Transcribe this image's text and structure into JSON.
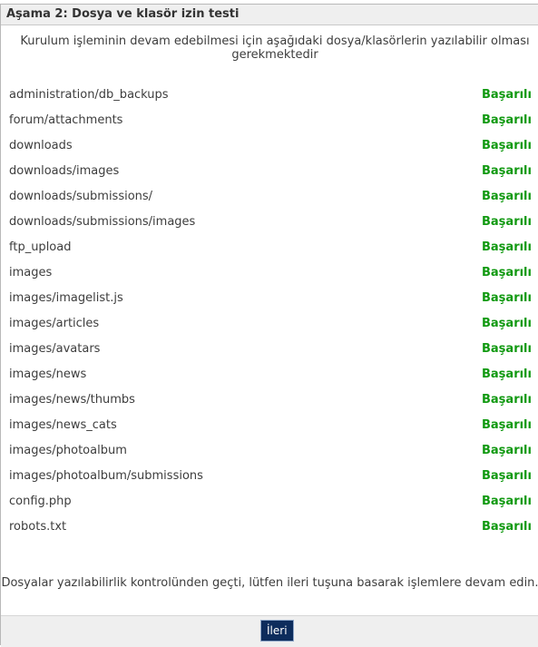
{
  "header": {
    "title": "Aşama 2: Dosya ve klasör izin testi"
  },
  "intro": {
    "text": "Kurulum işleminin devam edebilmesi için aşağıdaki dosya/klasörlerin yazılabilir olması gerekmektedir"
  },
  "files": [
    {
      "path": "administration/db_backups",
      "status": "Başarılı"
    },
    {
      "path": "forum/attachments",
      "status": "Başarılı"
    },
    {
      "path": "downloads",
      "status": "Başarılı"
    },
    {
      "path": "downloads/images",
      "status": "Başarılı"
    },
    {
      "path": "downloads/submissions/",
      "status": "Başarılı"
    },
    {
      "path": "downloads/submissions/images",
      "status": "Başarılı"
    },
    {
      "path": "ftp_upload",
      "status": "Başarılı"
    },
    {
      "path": "images",
      "status": "Başarılı"
    },
    {
      "path": "images/imagelist.js",
      "status": "Başarılı"
    },
    {
      "path": "images/articles",
      "status": "Başarılı"
    },
    {
      "path": "images/avatars",
      "status": "Başarılı"
    },
    {
      "path": "images/news",
      "status": "Başarılı"
    },
    {
      "path": "images/news/thumbs",
      "status": "Başarılı"
    },
    {
      "path": "images/news_cats",
      "status": "Başarılı"
    },
    {
      "path": "images/photoalbum",
      "status": "Başarılı"
    },
    {
      "path": "images/photoalbum/submissions",
      "status": "Başarılı"
    },
    {
      "path": "config.php",
      "status": "Başarılı"
    },
    {
      "path": "robots.txt",
      "status": "Başarılı"
    }
  ],
  "outro": {
    "text": "Dosyalar yazılabilirlik kontrolünden geçti, lütfen ileri tuşuna basarak işlemlere devam edin."
  },
  "footer": {
    "next_label": "İleri"
  },
  "colors": {
    "success": "#119911",
    "button_bg": "#0d2c5c",
    "header_bg": "#efefef"
  }
}
